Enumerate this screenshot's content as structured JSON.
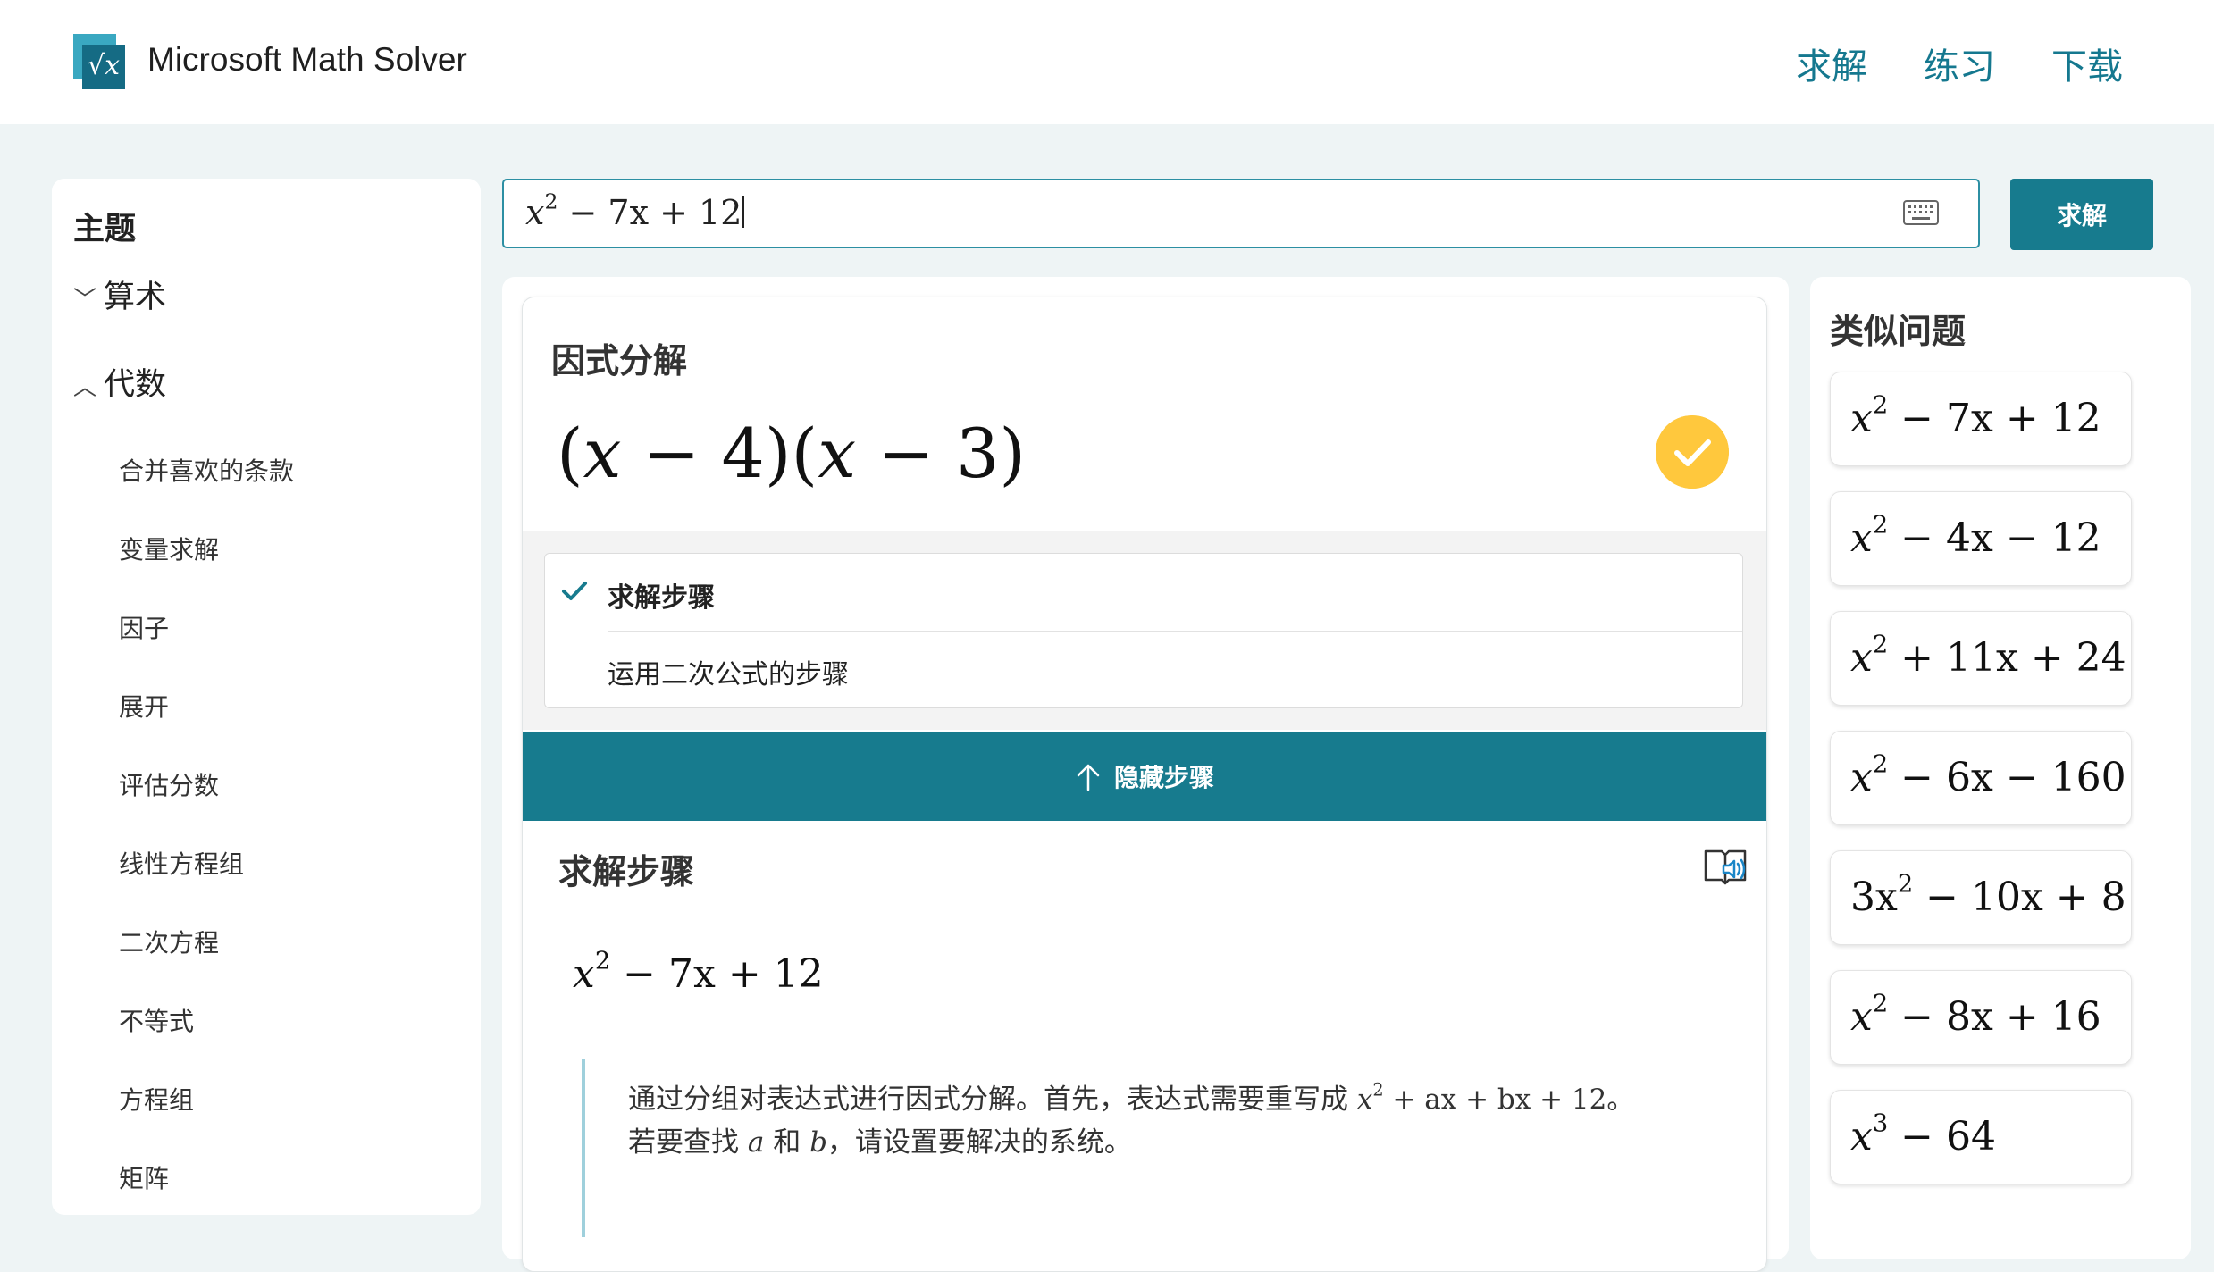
{
  "header": {
    "app_title": "Microsoft Math Solver",
    "logo_glyph": "√x",
    "nav": [
      "求解",
      "练习",
      "下载"
    ]
  },
  "sidebar": {
    "title": "主题",
    "categories": [
      {
        "label": "算术",
        "expanded": false
      },
      {
        "label": "代数",
        "expanded": true
      }
    ],
    "subtopics": [
      "合并喜欢的条款",
      "变量求解",
      "因子",
      "展开",
      "评估分数",
      "线性方程组",
      "二次方程",
      "不等式",
      "方程组",
      "矩阵"
    ]
  },
  "search": {
    "expression": "x^2 − 7x + 12",
    "solve_label": "求解"
  },
  "result": {
    "heading": "因式分解",
    "answer": "(x − 4)(x − 3)",
    "methods": [
      {
        "label": "求解步骤",
        "selected": true
      },
      {
        "label": "运用二次公式的步骤",
        "selected": false
      }
    ],
    "hide_steps_label": "隐藏步骤",
    "steps_heading": "求解步骤",
    "step_expression": "x^2 − 7x + 12",
    "step_text_1": "通过分组对表达式进行因式分解。首先，表达式需要重写成 x^2 + ax + bx + 12。",
    "step_text_2": "若要查找 a 和 b，请设置要解决的系统。"
  },
  "similar": {
    "title": "类似问题",
    "items": [
      "x^2 − 7x + 12",
      "x^2 − 4x − 12",
      "x^2 + 11x + 24",
      "x^2 − 6x − 160",
      "3x^2 − 10x + 8",
      "x^2 − 8x + 16",
      "x^3 − 64"
    ]
  },
  "colors": {
    "accent": "#177b8e",
    "link": "#15788f",
    "badge": "#ffc83d",
    "background": "#eef4f5"
  },
  "icons": [
    "logo-icon",
    "chevron-down-icon",
    "chevron-up-icon",
    "keyboard-icon",
    "checkmark-icon",
    "arrow-up-icon",
    "immersive-reader-icon"
  ]
}
